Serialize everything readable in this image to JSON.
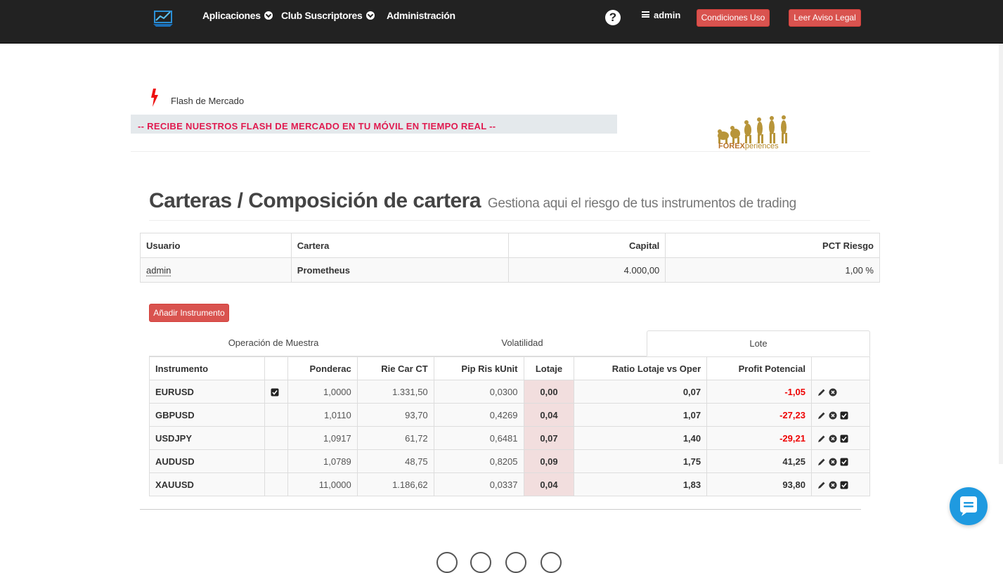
{
  "nav": {
    "items": [
      {
        "label": "Aplicaciones"
      },
      {
        "label": "Club Suscriptores"
      },
      {
        "label": "Administración"
      }
    ],
    "help_glyph": "?",
    "user": "admin",
    "conditions_button": "Condiciones Uso",
    "legal_button": "Leer Aviso Legal"
  },
  "flash": {
    "title": "Flash de Mercado",
    "banner": "-- RECIBE NUESTROS FLASH DE MERCADO EN TU MÓVIL EN TIEMPO REAL --"
  },
  "brand": {
    "logo_text_strong": "FOREX",
    "logo_text_rest": "periences"
  },
  "page": {
    "title": "Carteras / Composición de cartera",
    "subtitle": "Gestiona aqui el riesgo de tus instrumentos de trading"
  },
  "portfolio": {
    "headers": [
      "Usuario",
      "Cartera",
      "Capital",
      "PCT Riesgo"
    ],
    "row": {
      "usuario": "admin",
      "cartera": "Prometheus",
      "capital": "4.000,00",
      "pct_riesgo": "1,00 %"
    }
  },
  "add_instrument_button": "Añadir Instrumento",
  "tabs": [
    {
      "label": "Operación de Muestra",
      "active": false
    },
    {
      "label": "Volatilidad",
      "active": false
    },
    {
      "label": "Lote",
      "active": true
    }
  ],
  "instruments": {
    "headers": [
      "Instrumento",
      "",
      "Ponderac",
      "Rie Car CT",
      "Pip Ris kUnit",
      "Lotaje",
      "Ratio Lotaje vs Oper",
      "Profit Potencial",
      ""
    ],
    "rows": [
      {
        "symbol": "EURUSD",
        "checked": true,
        "ponderac": "1,0000",
        "rie_car_ct": "1.331,50",
        "pip_ris": "0,0300",
        "lotaje": "0,00",
        "ratio": "0,07",
        "profit": "-1,05",
        "profit_negative": true,
        "actions": [
          "edit",
          "remove"
        ]
      },
      {
        "symbol": "GBPUSD",
        "checked": false,
        "ponderac": "1,0110",
        "rie_car_ct": "93,70",
        "pip_ris": "0,4269",
        "lotaje": "0,04",
        "ratio": "1,07",
        "profit": "-27,23",
        "profit_negative": true,
        "actions": [
          "edit",
          "remove",
          "check"
        ]
      },
      {
        "symbol": "USDJPY",
        "checked": false,
        "ponderac": "1,0917",
        "rie_car_ct": "61,72",
        "pip_ris": "0,6481",
        "lotaje": "0,07",
        "ratio": "1,40",
        "profit": "-29,21",
        "profit_negative": true,
        "actions": [
          "edit",
          "remove",
          "check"
        ]
      },
      {
        "symbol": "AUDUSD",
        "checked": false,
        "ponderac": "1,0789",
        "rie_car_ct": "48,75",
        "pip_ris": "0,8205",
        "lotaje": "0,09",
        "ratio": "1,75",
        "profit": "41,25",
        "profit_negative": false,
        "actions": [
          "edit",
          "remove",
          "check"
        ]
      },
      {
        "symbol": "XAUUSD",
        "checked": false,
        "ponderac": "11,0000",
        "rie_car_ct": "1.186,62",
        "pip_ris": "0,0337",
        "lotaje": "0,04",
        "ratio": "1,83",
        "profit": "93,80",
        "profit_negative": false,
        "actions": [
          "edit",
          "remove",
          "check"
        ]
      }
    ]
  },
  "colors": {
    "navbar": "#222222",
    "danger": "#d9534f",
    "banner_text": "#e01a4f",
    "negative": "#ee0000",
    "lot_bg": "#f2dede",
    "chat": "#1f9ae0"
  }
}
